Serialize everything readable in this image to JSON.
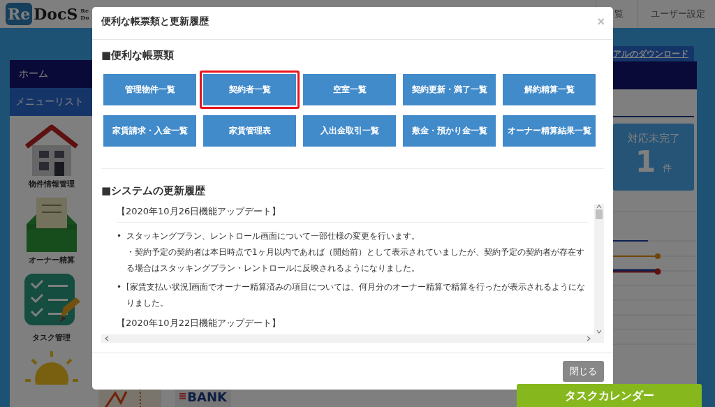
{
  "header": {
    "logo": {
      "part_1": "Re",
      "part_2": "DocS"
    },
    "logo_sub": [
      "Re",
      "Do"
    ],
    "nav": [
      {
        "label": "覧"
      },
      {
        "label": "ユーザー設定"
      }
    ]
  },
  "sidebar": {
    "home": "ホーム",
    "menu_title": "メニューリスト",
    "items": [
      {
        "kind": "house",
        "label": "物件情報管理"
      },
      {
        "kind": "tray",
        "label": "オーナー精算"
      },
      {
        "kind": "checklist",
        "label": "タスク管理"
      },
      {
        "kind": "sun"
      }
    ]
  },
  "content": {
    "bottom_icons": [
      {
        "kind": "chart"
      },
      {
        "kind": "bank",
        "text": "BANK"
      }
    ]
  },
  "right_panel": {
    "download_link": "アルのダウンロード",
    "status_card": {
      "label": "対応未完了",
      "count": "1",
      "unit": "件"
    }
  },
  "modal": {
    "title": "便利な帳票類と更新履歴",
    "close": "×",
    "forms_heading": "■便利な帳票類",
    "forms": [
      {
        "label": "管理物件一覧",
        "highlighted": false
      },
      {
        "label": "契約者一覧",
        "highlighted": true
      },
      {
        "label": "空室一覧",
        "highlighted": false
      },
      {
        "label": "契約更新・満了一覧",
        "highlighted": false
      },
      {
        "label": "解約精算一覧",
        "highlighted": false
      },
      {
        "label": "家賃請求・入金一覧",
        "highlighted": false
      },
      {
        "label": "家賃管理表",
        "highlighted": false
      },
      {
        "label": "入出金取引一覧",
        "highlighted": false
      },
      {
        "label": "敷金・預かり金一覧",
        "highlighted": false
      },
      {
        "label": "オーナー精算結果一覧",
        "highlighted": false
      }
    ],
    "history_heading": "■システムの更新履歴",
    "history": [
      {
        "title": "【2020年10月26日機能アップデート】",
        "items": [
          {
            "marker": "•",
            "text": "スタッキングプラン、レントロール画面について一部仕様の変更を行います。",
            "note": "・契約予定の契約者は本日時点で1ヶ月以内であれば（開始前）として表示されていましたが、契約予定の契約者が存在する場合はスタッキングプラン・レントロールに反映されるようになりました。"
          },
          {
            "marker": "•",
            "text": "[家賃支払い状況]画面でオーナー精算済みの項目については、何月分のオーナー精算で精算を行ったが表示されるようになりました。"
          }
        ]
      },
      {
        "title": "【2020年10月22日機能アップデート】"
      }
    ],
    "close_button": "閉じる"
  },
  "task_calendar": "タスクカレンダー"
}
